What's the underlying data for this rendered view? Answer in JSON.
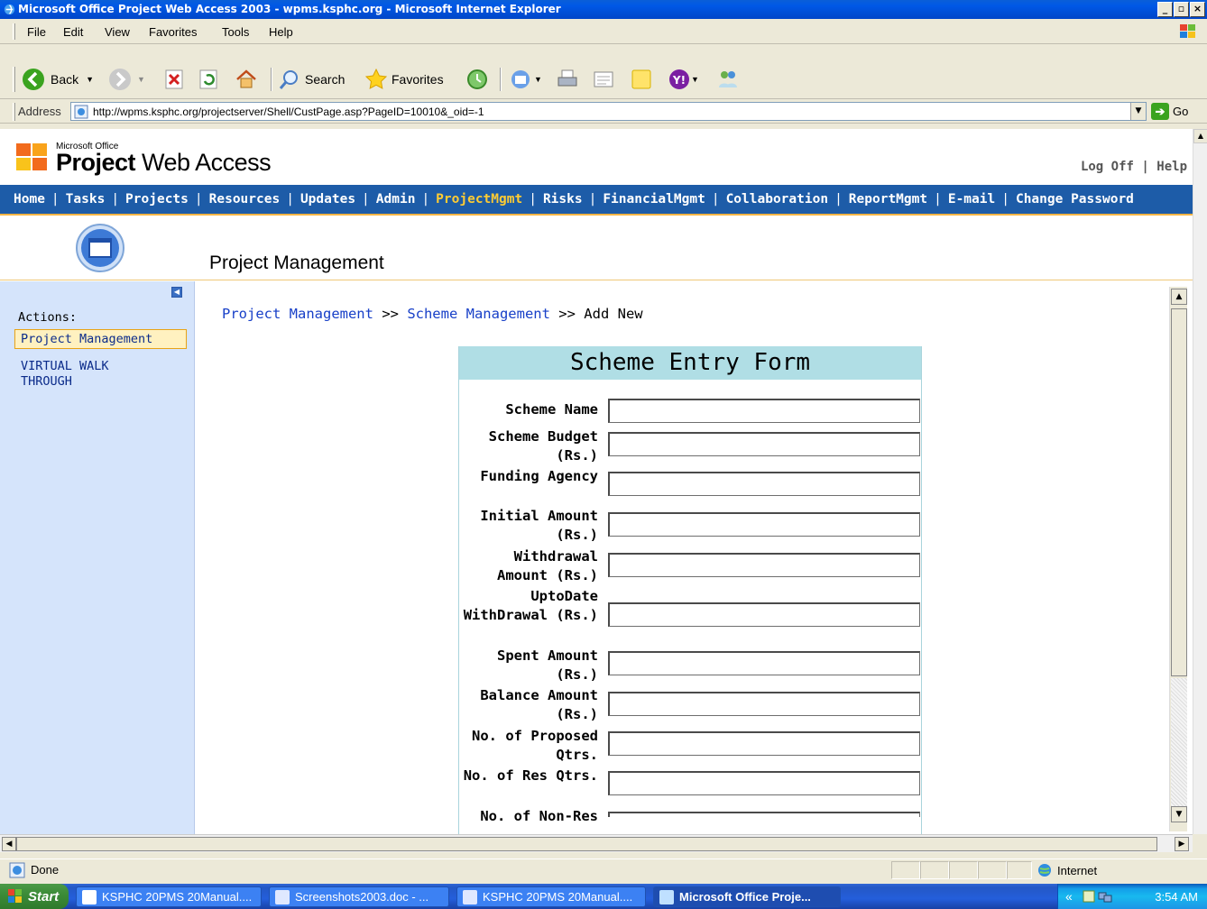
{
  "window": {
    "title": "Microsoft Office Project Web Access 2003 - wpms.ksphc.org - Microsoft Internet Explorer",
    "controls": [
      "_",
      "▫",
      "×"
    ]
  },
  "menu": [
    "File",
    "Edit",
    "View",
    "Favorites",
    "Tools",
    "Help"
  ],
  "toolbar": {
    "back": "Back",
    "search": "Search",
    "favorites": "Favorites"
  },
  "address": {
    "label": "Address",
    "url": "http://wpms.ksphc.org/projectserver/Shell/CustPage.asp?PageID=10010&_oid=-1",
    "go": "Go"
  },
  "pwa": {
    "ms_office": "Microsoft Office",
    "title_bold": "Project",
    "title_rest": " Web Access",
    "logoff": "Log Off",
    "help": "Help",
    "divider": "|"
  },
  "nav": [
    {
      "label": "Home",
      "active": false
    },
    {
      "label": "Tasks",
      "active": false
    },
    {
      "label": "Projects",
      "active": false
    },
    {
      "label": "Resources",
      "active": false
    },
    {
      "label": "Updates",
      "active": false
    },
    {
      "label": "Admin",
      "active": false
    },
    {
      "label": "ProjectMgmt",
      "active": true
    },
    {
      "label": "Risks",
      "active": false
    },
    {
      "label": "FinancialMgmt",
      "active": false
    },
    {
      "label": "Collaboration",
      "active": false
    },
    {
      "label": "ReportMgmt",
      "active": false
    },
    {
      "label": "E-mail",
      "active": false
    },
    {
      "label": "Change Password",
      "active": false
    }
  ],
  "page_title": "Project Management",
  "sidebar": {
    "actions_label": "Actions:",
    "active_link": "Project Management",
    "link2": "VIRTUAL WALK THROUGH"
  },
  "breadcrumb": {
    "crumb1": "Project Management",
    "sep": " >> ",
    "crumb2": "Scheme Management",
    "current": "Add New"
  },
  "form": {
    "heading": "Scheme Entry Form",
    "fields": [
      {
        "label": "Scheme Name",
        "value": ""
      },
      {
        "label": "Scheme Budget (Rs.)",
        "value": ""
      },
      {
        "label": "Funding Agency",
        "value": ""
      },
      {
        "label": "Initial Amount (Rs.)",
        "value": ""
      },
      {
        "label": "Withdrawal Amount (Rs.)",
        "value": ""
      },
      {
        "label": "UptoDate WithDrawal (Rs.)",
        "value": ""
      },
      {
        "label": "Spent Amount (Rs.)",
        "value": ""
      },
      {
        "label": "Balance Amount (Rs.)",
        "value": ""
      },
      {
        "label": "No. of Proposed Qtrs.",
        "value": ""
      },
      {
        "label": "No. of Res Qtrs.",
        "value": ""
      },
      {
        "label": "No. of Non-Res",
        "value": ""
      }
    ]
  },
  "status": {
    "text": "Done",
    "zone": "Internet"
  },
  "taskbar": {
    "start": "Start",
    "tasks": [
      {
        "label": "KSPHC 20PMS 20Manual....",
        "active": false
      },
      {
        "label": "Screenshots2003.doc - ...",
        "active": false
      },
      {
        "label": "KSPHC 20PMS 20Manual....",
        "active": false
      },
      {
        "label": "Microsoft Office Proje...",
        "active": true
      }
    ],
    "tray_chevron": "«",
    "clock": "3:54 AM"
  },
  "colors": {
    "nav_bg": "#1d5ca8",
    "nav_active": "#ffcc33",
    "sidebar_bg": "#d5e4fb",
    "form_head_bg": "#b0dee5",
    "link": "#1840c8"
  }
}
